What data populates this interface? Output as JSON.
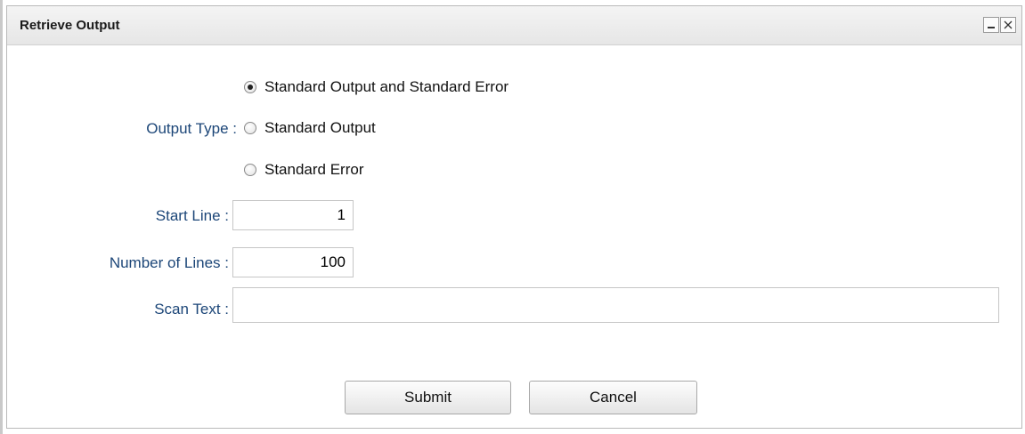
{
  "window": {
    "title": "Retrieve Output"
  },
  "titlebar_buttons": {
    "minimize": "minimize-icon",
    "close": "close-icon"
  },
  "form": {
    "output_type": {
      "label": "Output Type :",
      "options": [
        {
          "label": "Standard Output and Standard Error",
          "checked": true
        },
        {
          "label": "Standard Output",
          "checked": false
        },
        {
          "label": "Standard Error",
          "checked": false
        }
      ]
    },
    "start_line": {
      "label": "Start Line :",
      "value": "1"
    },
    "number_of_lines": {
      "label": "Number of Lines :",
      "value": "100"
    },
    "scan_text": {
      "label": "Scan Text :",
      "value": ""
    }
  },
  "buttons": {
    "submit": "Submit",
    "cancel": "Cancel"
  },
  "colors": {
    "label": "#1c4678",
    "title_text": "#1a1a1a",
    "border": "#b9b9b9"
  }
}
